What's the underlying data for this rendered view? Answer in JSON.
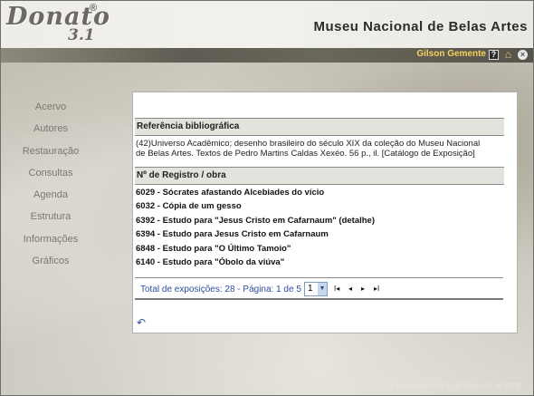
{
  "header": {
    "logo_text": "Donato",
    "logo_version": "3.1",
    "logo_reg": "®",
    "museum_title": "Museu Nacional de Belas Artes"
  },
  "userbar": {
    "user_name": "Gilson Gemente",
    "help_icon": "?",
    "home_icon": "⌂",
    "exit_icon": "×"
  },
  "sidebar": {
    "items": [
      {
        "label": "Acervo"
      },
      {
        "label": "Autores"
      },
      {
        "label": "Restauração"
      },
      {
        "label": "Consultas"
      },
      {
        "label": "Agenda"
      },
      {
        "label": "Estrutura"
      },
      {
        "label": "Informações"
      },
      {
        "label": "Gráficos"
      }
    ]
  },
  "main": {
    "ref_heading": "Referência bibliográfica",
    "ref_text": "(42)Universo Acadêmico; desenho brasileiro do século XIX da coleção do Museu Nacional de Belas Artes. Textos de Pedro Martins Caldas Xexéo. 56 p., il. [Catálogo de Exposição]",
    "works_heading": "Nº de Registro / obra",
    "works": [
      "6029 - Sócrates afastando Alcebiades do vício",
      "6032 - Cópia de um gesso",
      "6392 - Estudo para \"Jesus Cristo em Cafarnaum\" (detalhe)",
      "6394 - Estudo para Jesus Cristo em Cafarnaum",
      "6848 - Estudo para \"O Último Tamoio\"",
      "6140 - Estudo para \"Óbolo da viúva\""
    ],
    "pager": {
      "summary": "Total de exposições: 28 - Página: 1 de 5",
      "selected_page": "1",
      "first": "I◂",
      "prev": "◂",
      "next": "▸",
      "last": "▸I"
    },
    "back_icon": "↶"
  },
  "footer": {
    "text": "8 acessos desde 1º de fevereiro de 2008"
  },
  "colors": {
    "link_blue": "#2a4f9e",
    "user_yellow": "#f3d25a",
    "header_band": "#5e5c52"
  }
}
